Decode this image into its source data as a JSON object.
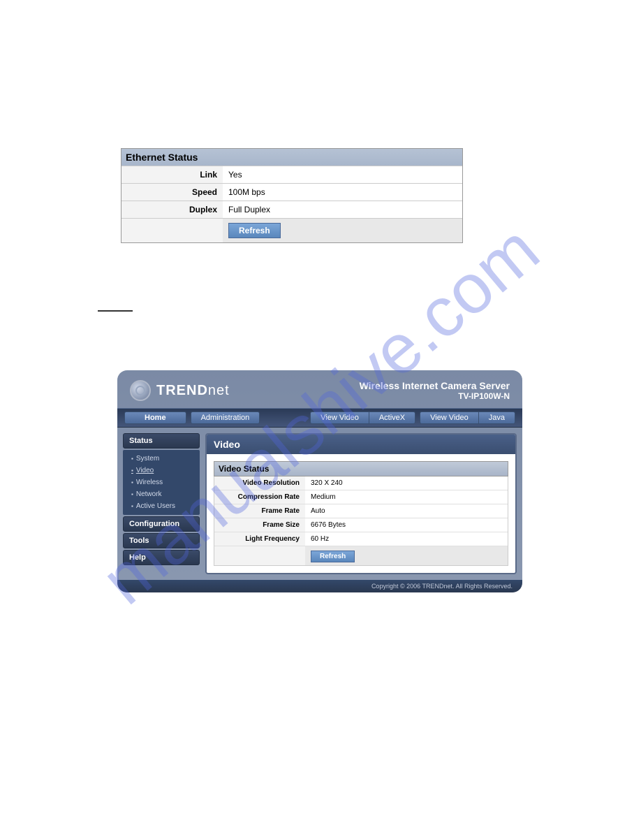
{
  "watermark": "manualshive.com",
  "ethernet": {
    "title": "Ethernet Status",
    "rows": [
      {
        "label": "Link",
        "value": "Yes"
      },
      {
        "label": "Speed",
        "value": "100M bps"
      },
      {
        "label": "Duplex",
        "value": "Full Duplex"
      }
    ],
    "refresh": "Refresh"
  },
  "router": {
    "brand_prefix": "TREND",
    "brand_suffix": "net",
    "header_title": "Wireless Internet Camera Server",
    "header_model": "TV-IP100W-N",
    "nav": {
      "home": "Home",
      "admin": "Administration",
      "view_video": "View Video",
      "activex": "ActiveX",
      "java": "Java"
    },
    "sidebar": {
      "status": {
        "label": "Status",
        "items": [
          "System",
          "Video",
          "Wireless",
          "Network",
          "Active Users"
        ]
      },
      "configuration": "Configuration",
      "tools": "Tools",
      "help": "Help"
    },
    "content": {
      "title": "Video",
      "section": "Video Status",
      "rows": [
        {
          "label": "Video Resolution",
          "value": "320 X 240"
        },
        {
          "label": "Compression Rate",
          "value": "Medium"
        },
        {
          "label": "Frame Rate",
          "value": "Auto"
        },
        {
          "label": "Frame Size",
          "value": "6676 Bytes"
        },
        {
          "label": "Light Frequency",
          "value": "60 Hz"
        }
      ],
      "refresh": "Refresh"
    },
    "footer": "Copyright © 2006 TRENDnet. All Rights Reserved."
  }
}
